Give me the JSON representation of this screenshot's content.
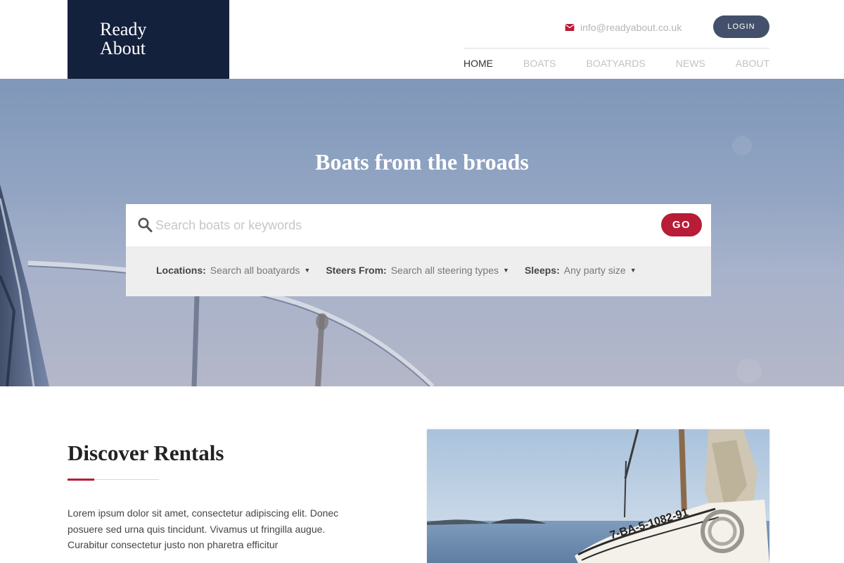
{
  "brand": {
    "line1": "Ready",
    "line2": "About"
  },
  "header": {
    "email": "info@readyabout.co.uk",
    "login_label": "LOGIN",
    "nav": [
      "HOME",
      "BOATS",
      "BOATYARDS",
      "NEWS",
      "ABOUT"
    ],
    "active_nav": "HOME"
  },
  "hero": {
    "title": "Boats from the broads",
    "search_placeholder": "Search boats or keywords",
    "go_label": "GO",
    "filters": [
      {
        "label": "Locations:",
        "value": "Search all boatyards"
      },
      {
        "label": "Steers From:",
        "value": "Search all steering types"
      },
      {
        "label": "Sleeps:",
        "value": "Any party size"
      }
    ]
  },
  "discover": {
    "title": "Discover Rentals",
    "body": "Lorem ipsum dolor sit amet, consectetur adipiscing elit. Donec posuere sed urna quis tincidunt. Vivamus ut fringilla augue. Curabitur consectetur justo non pharetra efficitur",
    "boat_registration": "7-BA-5-1082-91"
  },
  "colors": {
    "navy": "#14213d",
    "accent_red": "#b81c36",
    "login_bg": "#43506b"
  },
  "icons": {
    "email": "envelope-icon",
    "search": "search-icon",
    "caret": "caret-down-icon"
  }
}
